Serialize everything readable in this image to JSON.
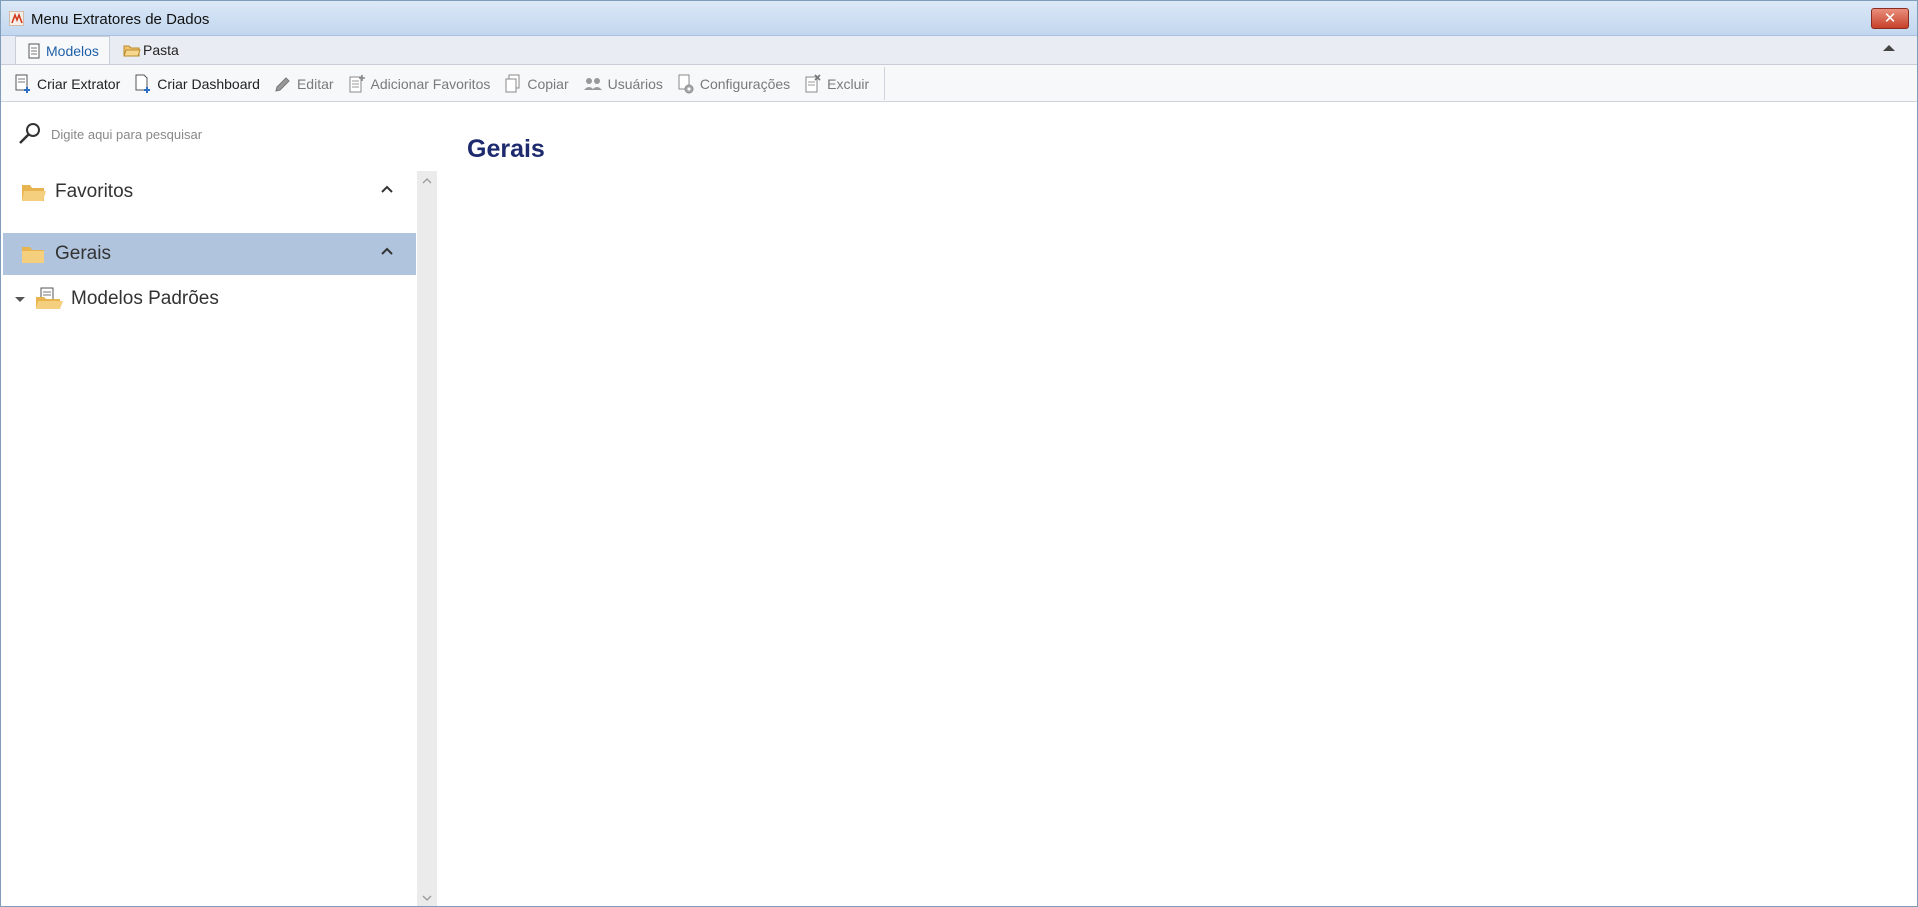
{
  "window": {
    "title": "Menu Extratores de Dados",
    "close_label": "✕"
  },
  "tabs": [
    {
      "label": "Modelos",
      "active": true
    },
    {
      "label": "Pasta",
      "active": false
    }
  ],
  "toolbar": {
    "criar_extrator": "Criar Extrator",
    "criar_dashboard": "Criar Dashboard",
    "editar": "Editar",
    "adicionar_favoritos": "Adicionar Favoritos",
    "copiar": "Copiar",
    "usuarios": "Usuários",
    "configuracoes": "Configurações",
    "excluir": "Excluir"
  },
  "search": {
    "placeholder": "Digite aqui para pesquisar"
  },
  "nav": {
    "favoritos": "Favoritos",
    "gerais": "Gerais",
    "modelos_padroes": "Modelos Padrões"
  },
  "main": {
    "title": "Gerais"
  },
  "colors": {
    "selected_group": "#b0c4de",
    "title_color": "#1d2a6e",
    "folder": "#f2c46d"
  },
  "icons": [
    "app-icon",
    "modelos-icon",
    "pasta-icon",
    "criar-extrator-icon",
    "criar-dashboard-icon",
    "pencil-icon",
    "favorites-add-icon",
    "copy-icon",
    "users-icon",
    "settings-icon",
    "delete-icon",
    "search-icon",
    "folder-icon",
    "chevron-up-icon",
    "expand-arrow-icon",
    "folder-doc-icon"
  ]
}
